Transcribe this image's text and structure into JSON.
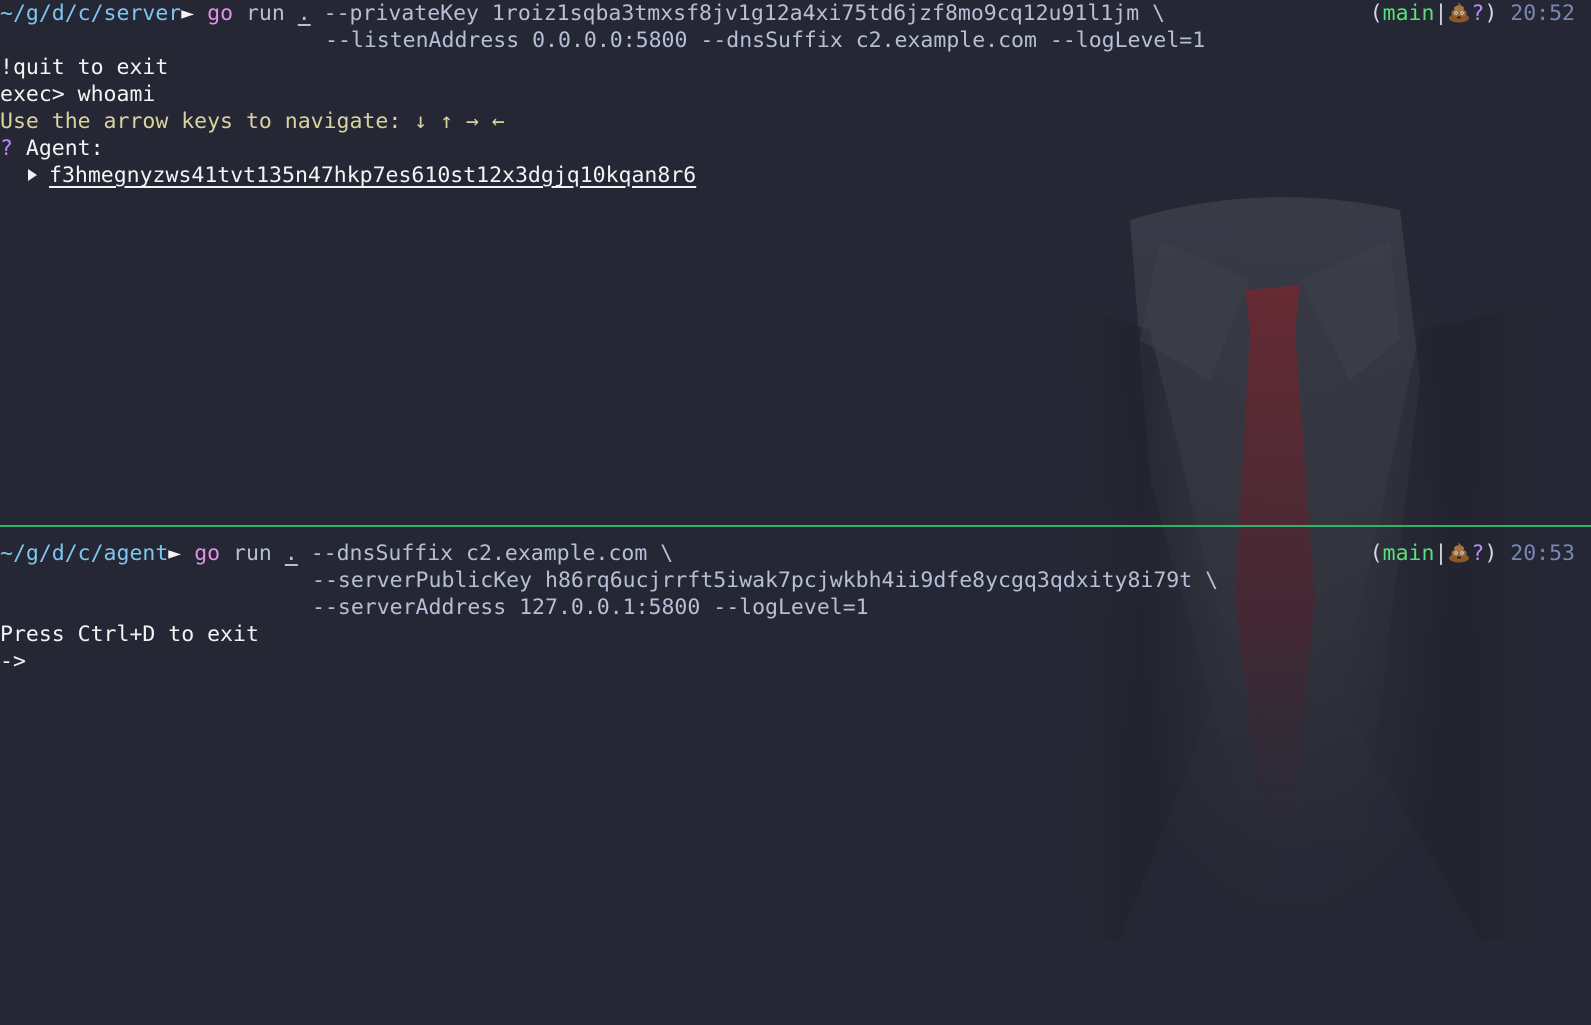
{
  "colors": {
    "background": "#252734",
    "path": "#7cc7f2",
    "command": "#e58fe6",
    "args": "#b7bfd6",
    "hint": "#d9d3a0",
    "branch": "#58e07a",
    "divider": "#2fb26a",
    "time": "#7a86b3"
  },
  "top_pane": {
    "path": "~/g/d/c/server",
    "prompt_arrow": "►",
    "cmd_go": "go",
    "cmd_run": "run",
    "cmd_dot": ".",
    "args_line1": " --privateKey 1roiz1sqba3tmxsf8jv1g12a4xi75td6jzf8mo9cq12u91l1jm \\",
    "args_line2": "--listenAddress 0.0.0.0:5800 --dnsSuffix c2.example.com --logLevel=1",
    "git_open": "(",
    "git_branch": "main",
    "git_sep": "|",
    "git_icon": "poo-icon",
    "git_status": "?",
    "git_close": ")",
    "time": "20:52",
    "output": {
      "quit_hint": "!quit to exit",
      "exec_prompt": "exec> ",
      "exec_command": "whoami",
      "navigate_hint": "Use the arrow keys to navigate: ↓ ↑ → ←",
      "question_mark": "?",
      "agent_label": " Agent:",
      "agent_id": "f3hmegnyzws41tvt135n47hkp7es610st12x3dgjq10kqan8r6"
    }
  },
  "bottom_pane": {
    "path": "~/g/d/c/agent",
    "prompt_arrow": "►",
    "cmd_go": "go",
    "cmd_run": "run",
    "cmd_dot": ".",
    "args_line1": " --dnsSuffix c2.example.com \\",
    "args_line2": "--serverPublicKey h86rq6ucjrrft5iwak7pcjwkbh4ii9dfe8ycgq3qdxity8i79t \\",
    "args_line3": "--serverAddress 127.0.0.1:5800 --logLevel=1",
    "git_open": "(",
    "git_branch": "main",
    "git_sep": "|",
    "git_icon": "poo-icon",
    "git_status": "?",
    "git_close": ")",
    "time": "20:53",
    "output": {
      "exit_hint": "Press Ctrl+D to exit",
      "input_prompt": "->"
    }
  }
}
